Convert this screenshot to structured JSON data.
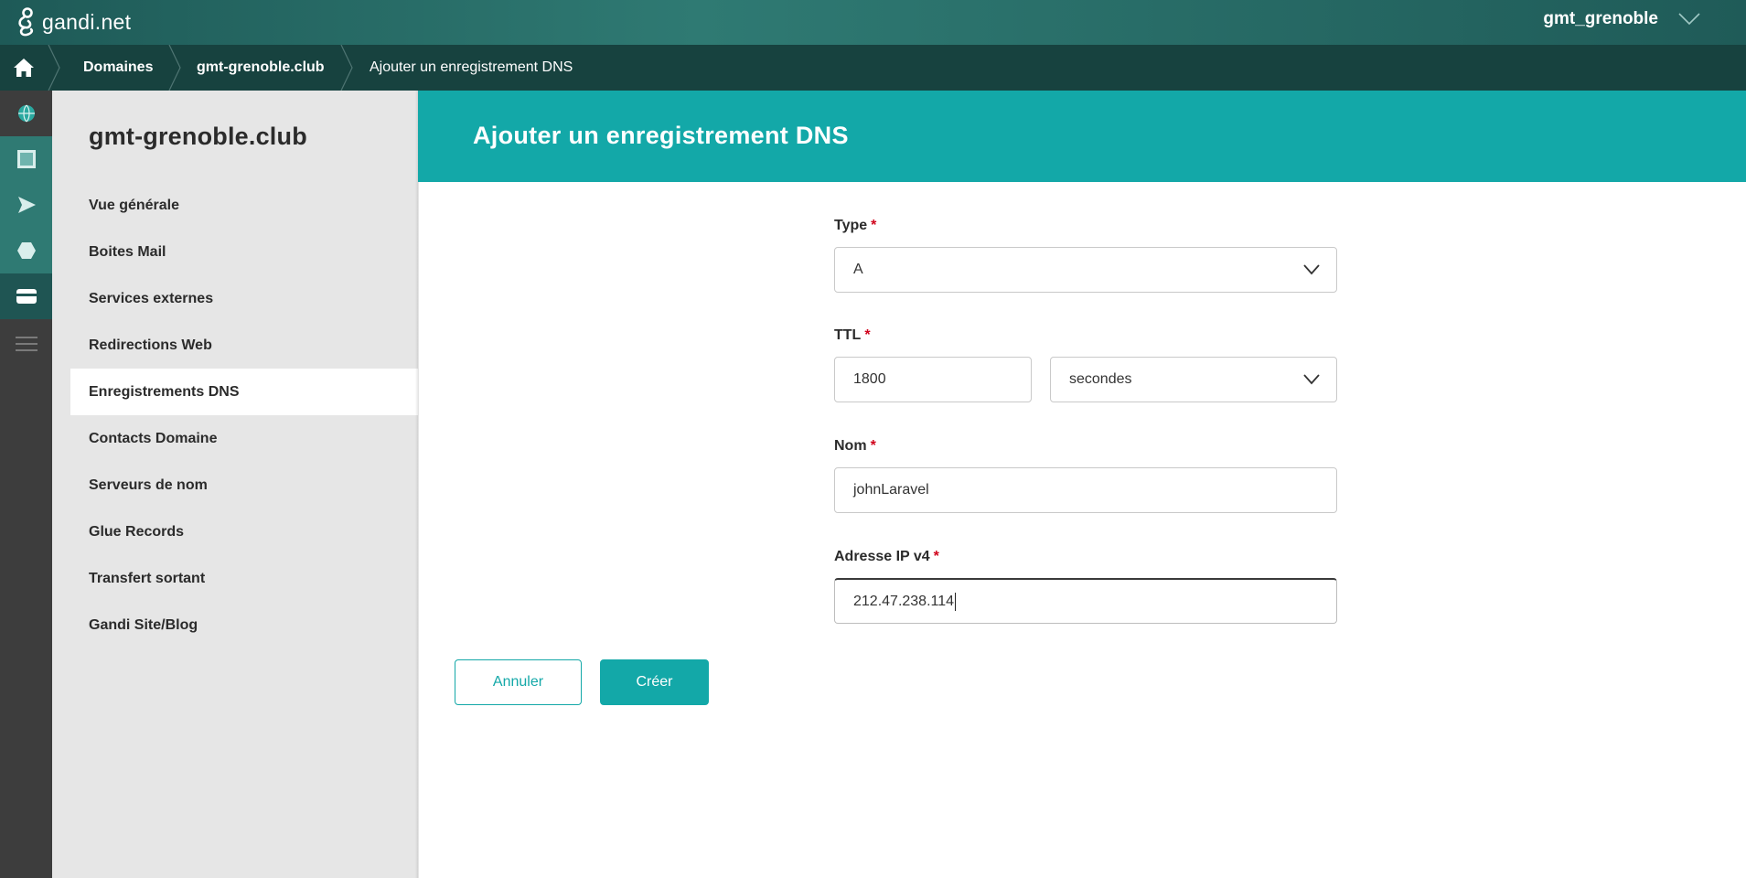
{
  "header": {
    "logo_text": "gandi.net",
    "user_name": "gmt_grenoble"
  },
  "breadcrumb": {
    "items": [
      "Domaines",
      "gmt-grenoble.club",
      "Ajouter un enregistrement DNS"
    ]
  },
  "sidebar": {
    "domain": "gmt-grenoble.club",
    "items": [
      {
        "label": "Vue générale"
      },
      {
        "label": "Boites Mail"
      },
      {
        "label": "Services externes"
      },
      {
        "label": "Redirections Web"
      },
      {
        "label": "Enregistrements DNS",
        "active": true
      },
      {
        "label": "Contacts Domaine"
      },
      {
        "label": "Serveurs de nom"
      },
      {
        "label": "Glue Records"
      },
      {
        "label": "Transfert sortant"
      },
      {
        "label": "Gandi Site/Blog"
      }
    ]
  },
  "page": {
    "title": "Ajouter un enregistrement DNS"
  },
  "form": {
    "required_mark": "*",
    "type": {
      "label": "Type",
      "value": "A"
    },
    "ttl": {
      "label": "TTL",
      "value": "1800",
      "unit": "secondes"
    },
    "name": {
      "label": "Nom",
      "value": "johnLaravel"
    },
    "ipv4": {
      "label": "Adresse IP v4",
      "value": "212.47.238.114"
    }
  },
  "actions": {
    "cancel": "Annuler",
    "create": "Créer"
  },
  "colors": {
    "accent": "#13a8a8",
    "header_dark": "#17423f",
    "rail": "#3d3d3d",
    "required": "#d0021b"
  }
}
